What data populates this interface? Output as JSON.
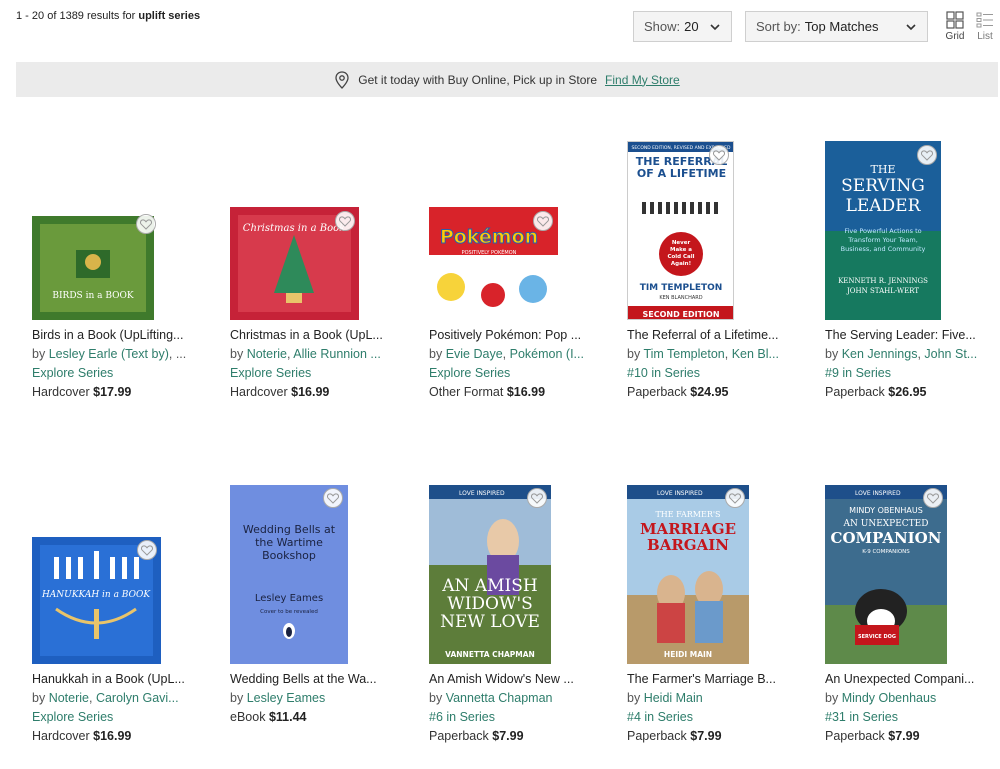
{
  "results": {
    "range": "1 - 20",
    "of": "of",
    "total": "1389",
    "suffix": "results for",
    "query": "uplift series"
  },
  "show": {
    "label": "Show:",
    "value": "20"
  },
  "sort": {
    "label": "Sort by:",
    "value": "Top Matches"
  },
  "view": {
    "grid": "Grid",
    "list": "List"
  },
  "banner": {
    "text": "Get it today with Buy Online, Pick up in Store",
    "link": "Find My Store"
  },
  "colors": {
    "accent": "#2e7d6b",
    "banner_bg": "#ebebeb"
  },
  "products": [
    {
      "title": "Birds in a Book (UpLifting...",
      "by": "by",
      "author1": "Lesley Earle (Text by)",
      "author_sep": ", ",
      "author2": "...",
      "series": "Explore Series",
      "format": "Hardcover",
      "price": "$17.99",
      "cover_text": "BIRDS in a BOOK",
      "cover_color": "#5f8d3a"
    },
    {
      "title": "Christmas in a Book (UpL...",
      "by": "by",
      "author1": "Noterie",
      "author_sep": ", ",
      "author2": "Allie Runnion ...",
      "series": "Explore Series",
      "format": "Hardcover",
      "price": "$16.99",
      "cover_text": "Christmas in a Book",
      "cover_color": "#c8233a"
    },
    {
      "title": "Positively Pokémon: Pop ...",
      "by": "by",
      "author1": "Evie Daye",
      "author_sep": ", ",
      "author2": "Pokémon (I...",
      "series": "Explore Series",
      "format": "Other Format",
      "price": "$16.99",
      "cover_text": "Pokémon",
      "cover_subtext": "POSITIVELY POKÉMON",
      "cover_color": "#d8232a"
    },
    {
      "title": "The Referral of a Lifetime...",
      "by": "by",
      "author1": "Tim Templeton",
      "author_sep": ", ",
      "author2": "Ken Bl...",
      "series": "#10 in Series",
      "format": "Paperback",
      "price": "$24.95",
      "cover_top": "SECOND EDITION, REVISED AND EXPANDED",
      "cover_text": "THE REFERRAL OF A LIFETIME",
      "cover_badge": "Never Make a Cold Call Again!",
      "cover_author": "TIM TEMPLETON",
      "cover_foreword": "KEN BLANCHARD",
      "cover_bottom": "SECOND EDITION",
      "cover_color": "#1b4f8f"
    },
    {
      "title": "The Serving Leader: Five...",
      "by": "by",
      "author1": "Ken Jennings",
      "author_sep": ", ",
      "author2": "John St...",
      "series": "#9 in Series",
      "format": "Paperback",
      "price": "$26.95",
      "cover_text1": "THE",
      "cover_text2": "SERVING",
      "cover_text3": "LEADER",
      "cover_sub": "Five Powerful Actions to Transform Your Team, Business, and Community",
      "cover_author": "KENNETH R. JENNINGS",
      "cover_author2": "JOHN STAHL-WERT",
      "cover_color": "#1a7a5e"
    },
    {
      "title": "Hanukkah in a Book (UpL...",
      "by": "by",
      "author1": "Noterie",
      "author_sep": ", ",
      "author2": "Carolyn Gavi...",
      "series": "Explore Series",
      "format": "Hardcover",
      "price": "$16.99",
      "cover_text": "HANUKKAH in a BOOK",
      "cover_color": "#1e5fc0"
    },
    {
      "title": "Wedding Bells at the Wa...",
      "by": "by",
      "author1": "Lesley Eames",
      "author_sep": "",
      "author2": "",
      "series": "",
      "format": "eBook",
      "price": "$11.44",
      "cover_text": "Wedding Bells at the Wartime Bookshop",
      "cover_author": "Lesley Eames",
      "cover_note": "Cover to be revealed",
      "cover_color": "#6f8ee0"
    },
    {
      "title": "An Amish Widow's New ...",
      "by": "by",
      "author1": "Vannetta Chapman",
      "author_sep": "",
      "author2": "",
      "series": "#6 in Series",
      "format": "Paperback",
      "price": "$7.99",
      "cover_text": "AN AMISH WIDOW'S NEW LOVE",
      "cover_author": "VANNETTA CHAPMAN",
      "cover_brand": "LOVE INSPIRED",
      "cover_color": "#6c8a4a"
    },
    {
      "title": "The Farmer's Marriage B...",
      "by": "by",
      "author1": "Heidi Main",
      "author_sep": "",
      "author2": "",
      "series": "#4 in Series",
      "format": "Paperback",
      "price": "$7.99",
      "cover_text1": "THE FARMER'S",
      "cover_text2": "MARRIAGE BARGAIN",
      "cover_author": "HEIDI MAIN",
      "cover_brand": "LOVE INSPIRED",
      "cover_color": "#8fb8d8"
    },
    {
      "title": "An Unexpected Compani...",
      "by": "by",
      "author1": "Mindy Obenhaus",
      "author_sep": "",
      "author2": "",
      "series": "#31 in Series",
      "format": "Paperback",
      "price": "$7.99",
      "cover_author": "MINDY OBENHAUS",
      "cover_text1": "AN UNEXPECTED",
      "cover_text2": "COMPANION",
      "cover_sub": "K-9 COMPANIONS",
      "cover_brand": "LOVE INSPIRED",
      "cover_badge": "SERVICE DOG",
      "cover_color": "#3d6c8e"
    }
  ]
}
